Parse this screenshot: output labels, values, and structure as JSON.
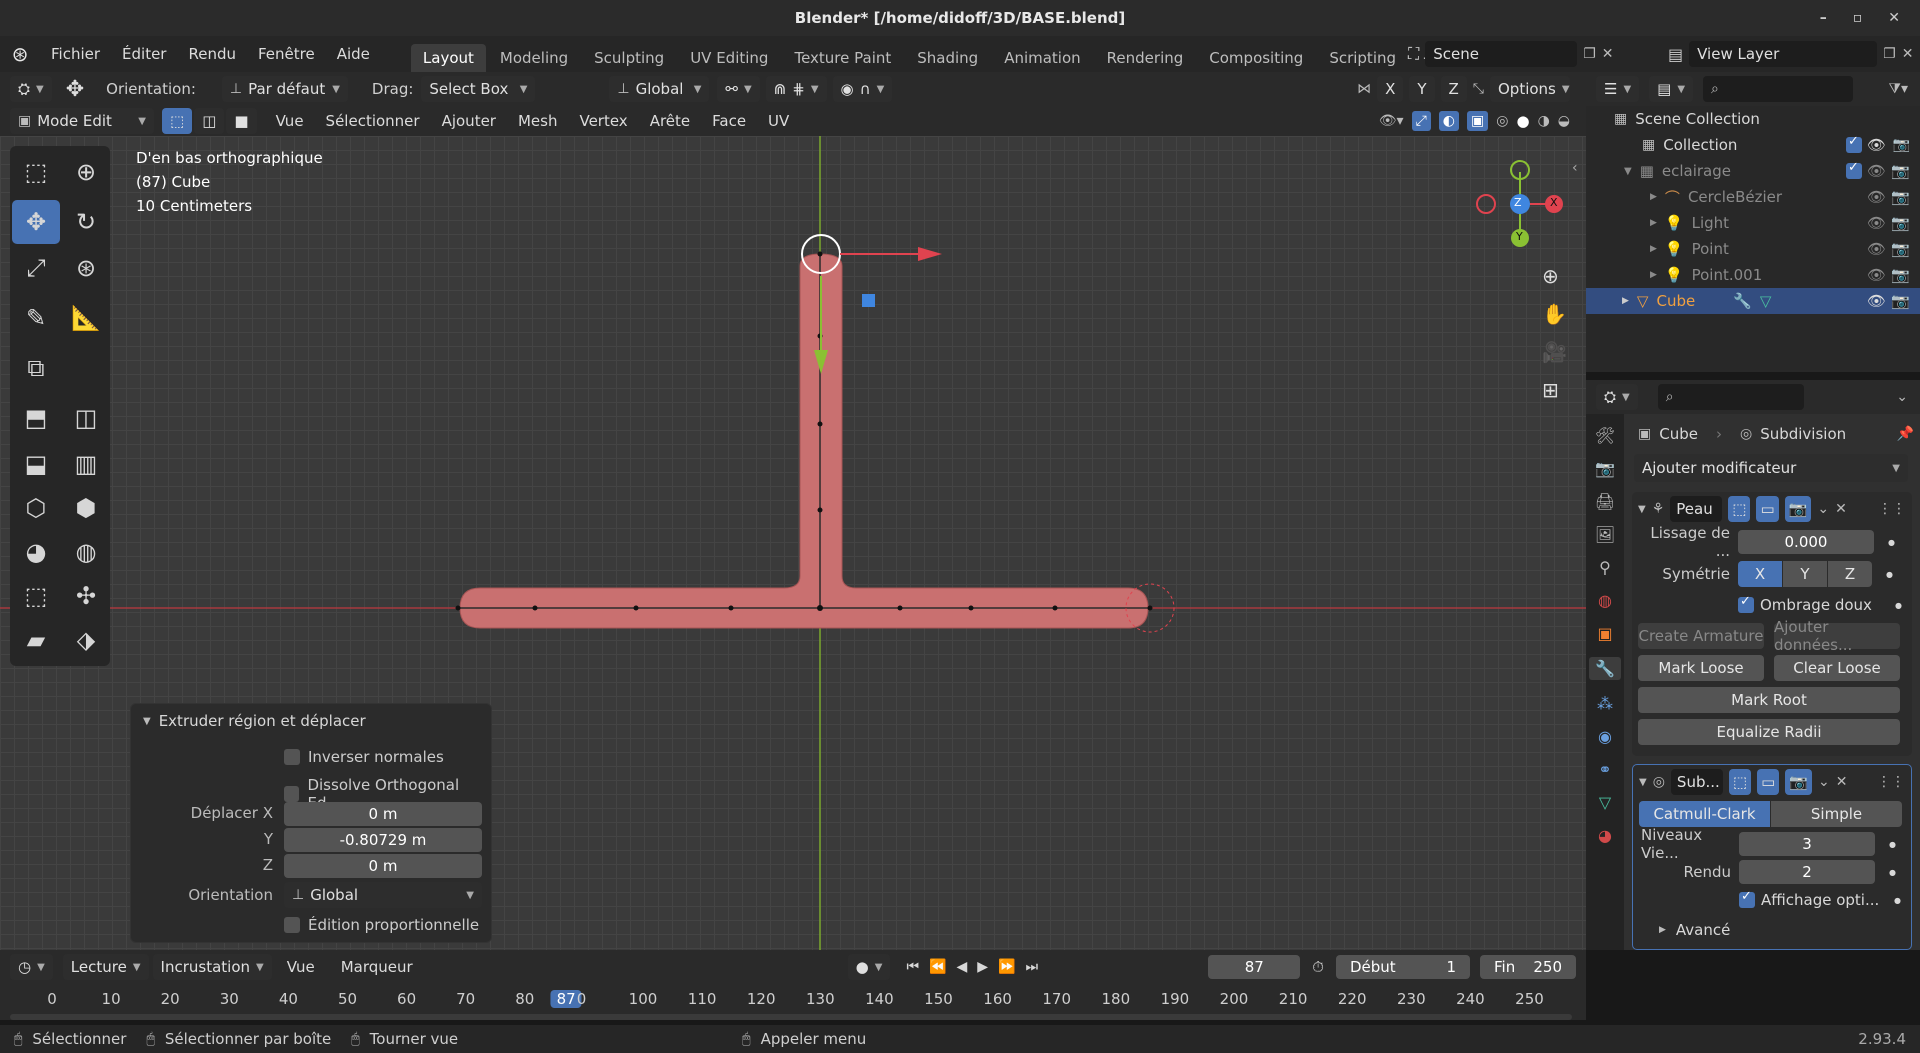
{
  "app": {
    "title": "Blender* [/home/didoff/3D/BASE.blend]",
    "version": "2.93.4"
  },
  "menu": {
    "items": [
      "Fichier",
      "Éditer",
      "Rendu",
      "Fenêtre",
      "Aide"
    ]
  },
  "workspaces": [
    "Layout",
    "Modeling",
    "Sculpting",
    "UV Editing",
    "Texture Paint",
    "Shading",
    "Animation",
    "Rendering",
    "Compositing",
    "Scripting"
  ],
  "scene": {
    "name": "Scene",
    "view_layer": "View Layer"
  },
  "toolbar": {
    "orientation_label": "Orientation:",
    "orientation_value": "Par défaut",
    "drag_label": "Drag:",
    "drag_value": "Select Box",
    "transform_value": "Global",
    "options_label": "Options",
    "axes": [
      "X",
      "Y",
      "Z"
    ]
  },
  "editbar": {
    "mode": "Mode Edit",
    "menus": [
      "Vue",
      "Sélectionner",
      "Ajouter",
      "Mesh",
      "Vertex",
      "Arête",
      "Face",
      "UV"
    ]
  },
  "viewport": {
    "view_name": "D'en bas orthographique",
    "object": "(87) Cube",
    "scale": "10 Centimeters",
    "gizmo": {
      "x": "X",
      "y": "Y",
      "z": "Z"
    }
  },
  "operator": {
    "title": "Extruder région et déplacer",
    "flip_normals": "Inverser normales",
    "dissolve": "Dissolve Orthogonal Ed...",
    "move_x_label": "Déplacer X",
    "move_x": "0 m",
    "move_y_label": "Y",
    "move_y": "-0.80729 m",
    "move_z_label": "Z",
    "move_z": "0 m",
    "orientation_label": "Orientation",
    "orientation_value": "Global",
    "proportional": "Édition proportionnelle"
  },
  "outliner": {
    "root": "Scene Collection",
    "items": [
      {
        "name": "Collection"
      },
      {
        "name": "eclairage"
      },
      {
        "name": "CercleBézier"
      },
      {
        "name": "Light"
      },
      {
        "name": "Point"
      },
      {
        "name": "Point.001"
      },
      {
        "name": "Cube"
      }
    ]
  },
  "properties": {
    "object": "Cube",
    "modifier_ctx": "Subdivision",
    "add_modifier": "Ajouter modificateur",
    "skin": {
      "name": "Peau",
      "smooth_label": "Lissage de ...",
      "smooth_value": "0.000",
      "symmetry_label": "Symétrie",
      "sym_x": "X",
      "sym_y": "Y",
      "sym_z": "Z",
      "smooth_shading": "Ombrage doux",
      "create_armature": "Create Armature",
      "add_data": "Ajouter données...",
      "mark_loose": "Mark Loose",
      "clear_loose": "Clear Loose",
      "mark_root": "Mark Root",
      "equalize": "Equalize Radii"
    },
    "subsurf": {
      "name": "Sub...",
      "catmull": "Catmull-Clark",
      "simple": "Simple",
      "levels_label": "Niveaux Vie...",
      "levels_value": "3",
      "render_label": "Rendu",
      "render_value": "2",
      "optimal": "Affichage opti...",
      "advanced": "Avancé"
    }
  },
  "timeline": {
    "menus": [
      "Lecture",
      "Incrustation",
      "Vue",
      "Marqueur"
    ],
    "current_frame": "87",
    "start_label": "Début",
    "start": "1",
    "end_label": "Fin",
    "end": "250",
    "ticks": [
      "0",
      "10",
      "20",
      "30",
      "40",
      "50",
      "60",
      "70",
      "80",
      "87",
      "0",
      "100",
      "110",
      "120",
      "130",
      "140",
      "150",
      "160",
      "170",
      "180",
      "190",
      "200",
      "210",
      "220",
      "230",
      "240",
      "250"
    ]
  },
  "status": {
    "select": "Sélectionner",
    "box_select": "Sélectionner par boîte",
    "rotate_view": "Tourner vue",
    "call_menu": "Appeler menu"
  },
  "colors": {
    "accent": "#4772b3",
    "mesh": "#c97070",
    "x_axis": "#e0434f",
    "y_axis": "#8ac133",
    "z_axis": "#3f86e0"
  }
}
